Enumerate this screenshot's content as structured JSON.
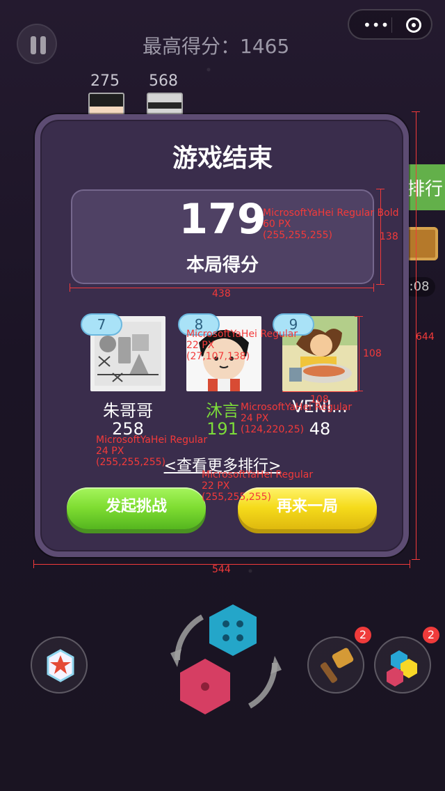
{
  "top_bar": {
    "best_score": "最高得分：1465",
    "capsule_dots": "•••"
  },
  "top_ranks": [
    {
      "rank": "275"
    },
    {
      "rank": "568"
    }
  ],
  "side": {
    "tab_label": "排行",
    "gift_time": ":08"
  },
  "modal": {
    "title": "游戏结束",
    "score": "179",
    "score_label": "本局得分",
    "more_link": "<查看更多排行>",
    "buttons": {
      "challenge": "发起挑战",
      "again": "再来一局"
    }
  },
  "leaderboard": [
    {
      "rank": "7",
      "name": "朱哥哥",
      "score": "258"
    },
    {
      "rank": "8",
      "name": "沐言",
      "score": "191"
    },
    {
      "rank": "9",
      "name": "VENI...",
      "score": "48"
    }
  ],
  "badges": {
    "hammer": "2",
    "blocks": "2"
  },
  "annotations": {
    "score_font": "MicrosoftYaHei Regular Bold\n60 PX\n(255,255,255)",
    "name_font": "MicrosoftYaHei Regular\n22 PX\n(27,107,138)",
    "me_font": "MicrosoftYaHei Regular\n24 PX\n(124,220,25)",
    "list_font": "MicrosoftYaHei Regular\n24 PX\n(255,255,255)",
    "link_font": "MicrosoftYaHei Regular\n22 PX\n(255,255,255)",
    "w_panel": "438",
    "h_panel": "138",
    "w_avatar": "108",
    "h_avatar": "108",
    "w_modal": "544",
    "h_modal": "644"
  },
  "colors": {
    "green_button": "#7fdd32",
    "yellow_button": "#f5db1b",
    "me_green": "#7cdc3a",
    "rank_bg": "#a9e2f7"
  }
}
